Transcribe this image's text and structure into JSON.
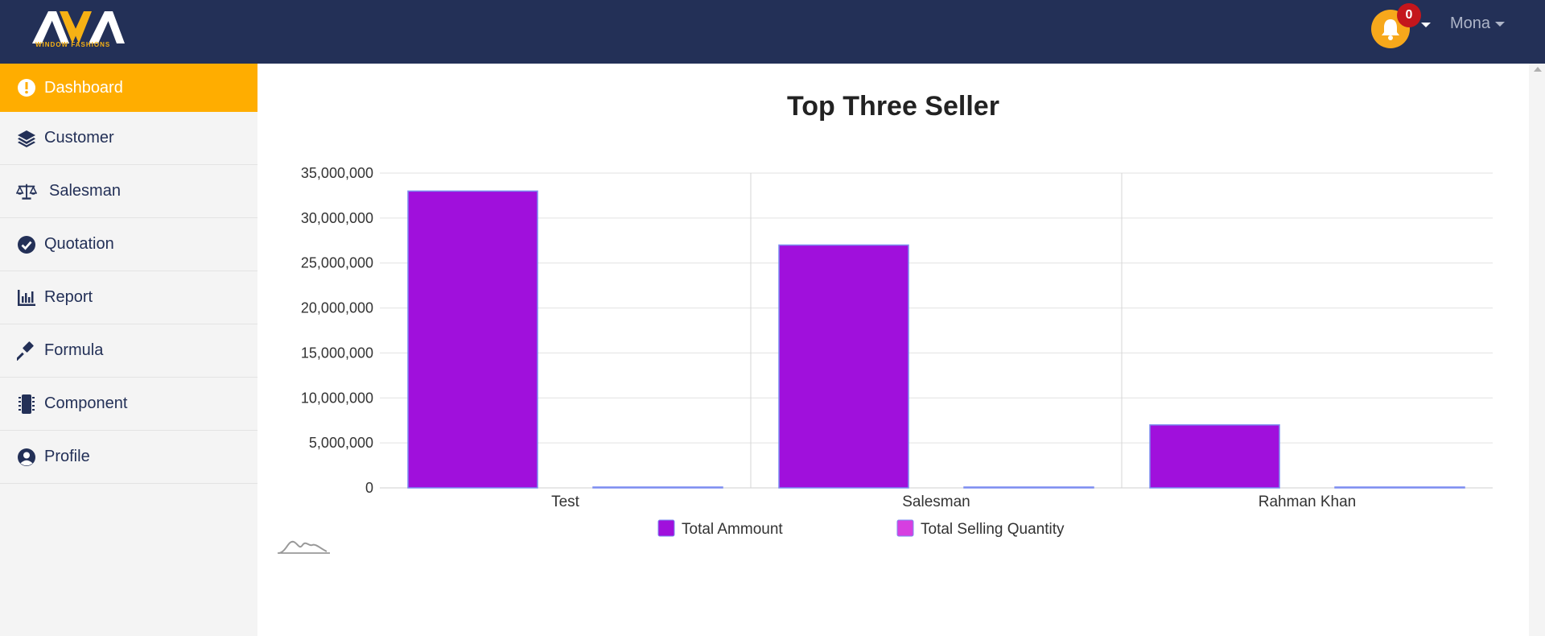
{
  "header": {
    "logo_text": "AVA",
    "logo_subtitle": "WINDOW FASHIONS",
    "notification_count": "0",
    "user_name": "Mona"
  },
  "sidebar": {
    "items": [
      {
        "label": "Dashboard",
        "icon": "exclamation-circle-icon",
        "active": true
      },
      {
        "label": "Customer",
        "icon": "layers-icon",
        "active": false
      },
      {
        "label": "Salesman",
        "icon": "balance-scale-icon",
        "active": false
      },
      {
        "label": "Quotation",
        "icon": "check-circle-icon",
        "active": false
      },
      {
        "label": "Report",
        "icon": "bar-chart-icon",
        "active": false
      },
      {
        "label": "Formula",
        "icon": "gavel-icon",
        "active": false
      },
      {
        "label": "Component",
        "icon": "chip-icon",
        "active": false
      },
      {
        "label": "Profile",
        "icon": "user-circle-icon",
        "active": false
      }
    ]
  },
  "colors": {
    "topbar": "#233057",
    "accent": "#ffad00",
    "series_amount": "#a010dc",
    "series_quantity": "#d63fe0"
  },
  "chart_data": {
    "type": "bar",
    "title": "Top Three Seller",
    "categories": [
      "Test",
      "Salesman",
      "Rahman Khan"
    ],
    "series": [
      {
        "name": "Total Ammount",
        "values": [
          33000000,
          27000000,
          7000000
        ]
      },
      {
        "name": "Total Selling Quantity",
        "values": [
          0,
          0,
          0
        ]
      }
    ],
    "ylim": [
      0,
      35000000
    ],
    "yticks": [
      "0",
      "5,000,000",
      "10,000,000",
      "15,000,000",
      "20,000,000",
      "25,000,000",
      "30,000,000",
      "35,000,000"
    ],
    "grid": true,
    "legend": "bottom"
  }
}
